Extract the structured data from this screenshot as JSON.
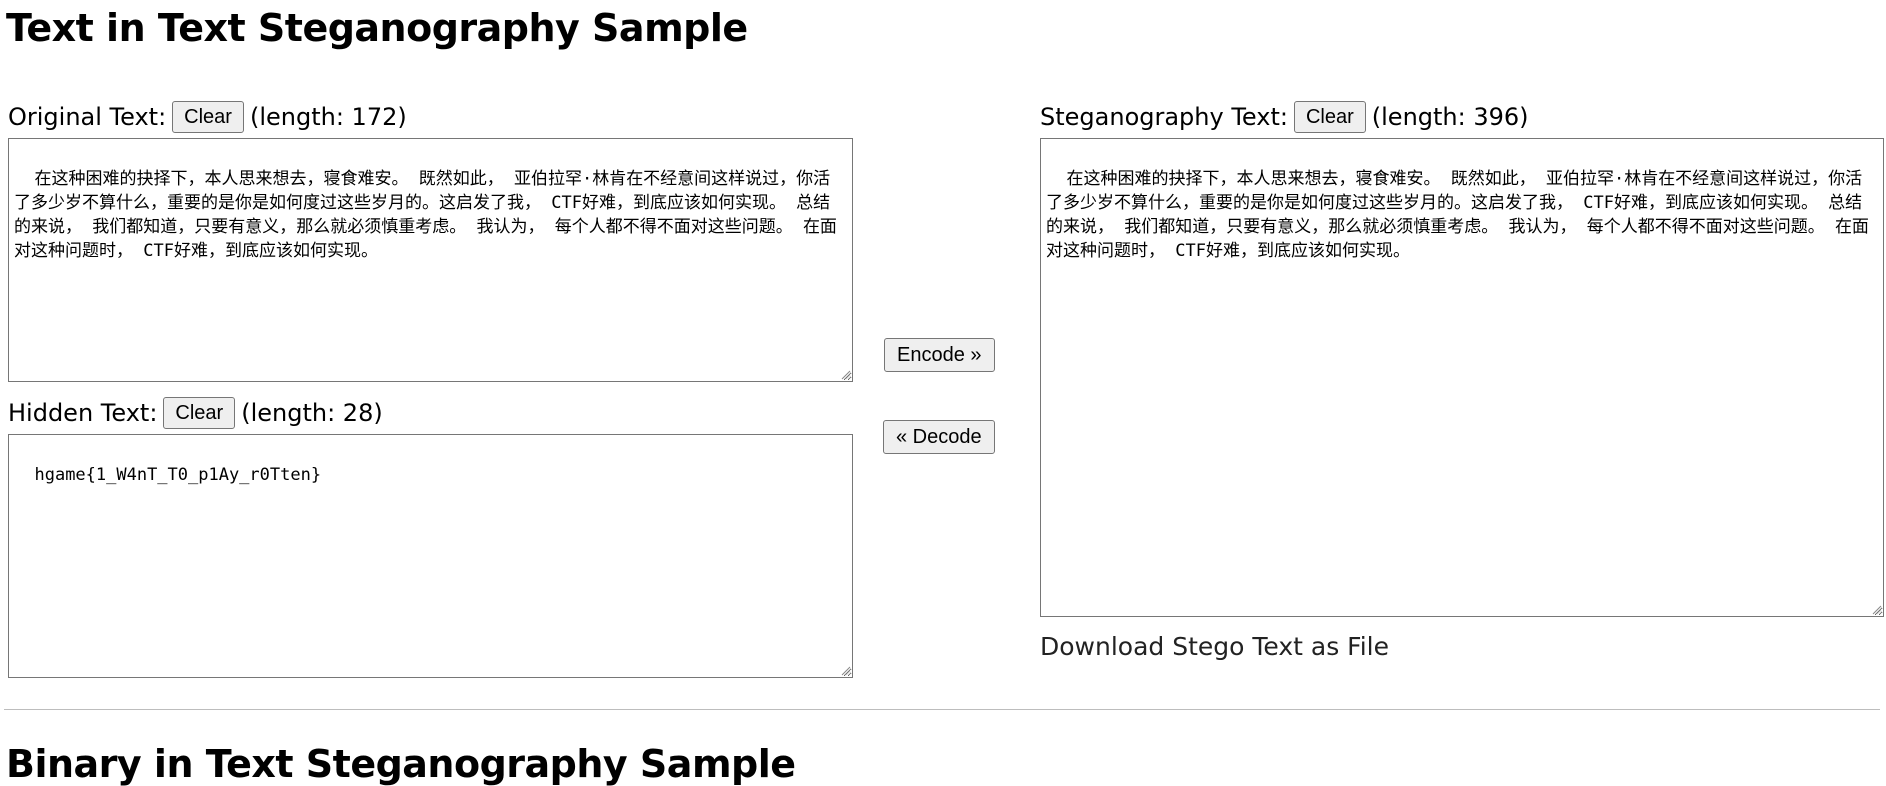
{
  "sections": {
    "text_title": "Text in Text Steganography Sample",
    "binary_title": "Binary in Text Steganography Sample"
  },
  "original": {
    "label": "Original Text:",
    "clear": "Clear",
    "length": "(length: 172)",
    "value": "在这种困难的抉择下，本人思来想去，寝食难安。 既然如此， 亚伯拉罕·林肯在不经意间这样说过，你活了多少岁不算什么，重要的是你是如何度过这些岁月的。这启发了我， CTF好难，到底应该如何实现。 总结的来说， 我们都知道，只要有意义，那么就必须慎重考虑。 我认为， 每个人都不得不面对这些问题。 在面对这种问题时， CTF好难，到底应该如何实现。"
  },
  "hidden": {
    "label": "Hidden Text:",
    "clear": "Clear",
    "length": "(length: 28)",
    "value": "hgame{1_W4nT_T0_p1Ay_r0Tten}"
  },
  "stego": {
    "label": "Steganography Text:",
    "clear": "Clear",
    "length": "(length: 396)",
    "value": "在这种困难的抉择下，本人思来想去，寝食难安。 既然如此， 亚伯拉罕·林肯在不经意间这样说过，你活了多少岁不算什么，重要的是你是如何度过这些岁月的。这启发了我， CTF好难，到底应该如何实现。 总结的来说， 我们都知道，只要有意义，那么就必须慎重考虑。 我认为， 每个人都不得不面对这些问题。 在面对这种问题时， CTF好难，到底应该如何实现。"
  },
  "actions": {
    "encode": "Encode »",
    "decode": "« Decode",
    "download": "Download Stego Text as File"
  }
}
